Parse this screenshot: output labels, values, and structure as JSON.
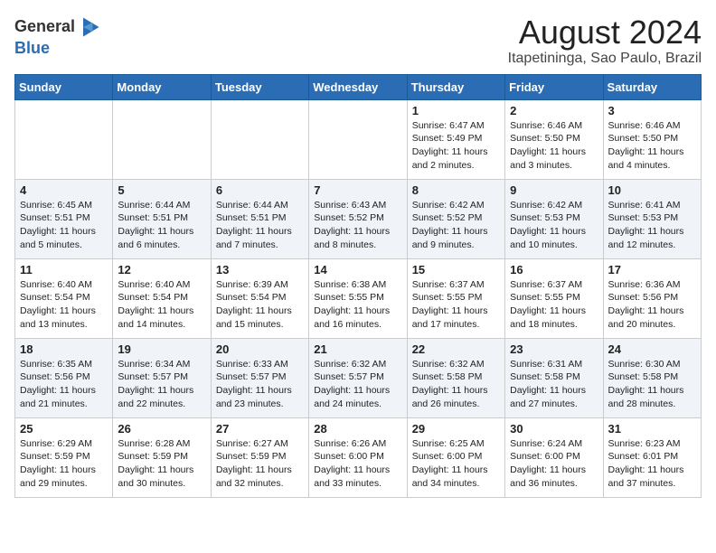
{
  "header": {
    "logo_general": "General",
    "logo_blue": "Blue",
    "month_year": "August 2024",
    "location": "Itapetininga, Sao Paulo, Brazil"
  },
  "days_of_week": [
    "Sunday",
    "Monday",
    "Tuesday",
    "Wednesday",
    "Thursday",
    "Friday",
    "Saturday"
  ],
  "weeks": [
    [
      {
        "day": "",
        "info": ""
      },
      {
        "day": "",
        "info": ""
      },
      {
        "day": "",
        "info": ""
      },
      {
        "day": "",
        "info": ""
      },
      {
        "day": "1",
        "info": "Sunrise: 6:47 AM\nSunset: 5:49 PM\nDaylight: 11 hours\nand 2 minutes."
      },
      {
        "day": "2",
        "info": "Sunrise: 6:46 AM\nSunset: 5:50 PM\nDaylight: 11 hours\nand 3 minutes."
      },
      {
        "day": "3",
        "info": "Sunrise: 6:46 AM\nSunset: 5:50 PM\nDaylight: 11 hours\nand 4 minutes."
      }
    ],
    [
      {
        "day": "4",
        "info": "Sunrise: 6:45 AM\nSunset: 5:51 PM\nDaylight: 11 hours\nand 5 minutes."
      },
      {
        "day": "5",
        "info": "Sunrise: 6:44 AM\nSunset: 5:51 PM\nDaylight: 11 hours\nand 6 minutes."
      },
      {
        "day": "6",
        "info": "Sunrise: 6:44 AM\nSunset: 5:51 PM\nDaylight: 11 hours\nand 7 minutes."
      },
      {
        "day": "7",
        "info": "Sunrise: 6:43 AM\nSunset: 5:52 PM\nDaylight: 11 hours\nand 8 minutes."
      },
      {
        "day": "8",
        "info": "Sunrise: 6:42 AM\nSunset: 5:52 PM\nDaylight: 11 hours\nand 9 minutes."
      },
      {
        "day": "9",
        "info": "Sunrise: 6:42 AM\nSunset: 5:53 PM\nDaylight: 11 hours\nand 10 minutes."
      },
      {
        "day": "10",
        "info": "Sunrise: 6:41 AM\nSunset: 5:53 PM\nDaylight: 11 hours\nand 12 minutes."
      }
    ],
    [
      {
        "day": "11",
        "info": "Sunrise: 6:40 AM\nSunset: 5:54 PM\nDaylight: 11 hours\nand 13 minutes."
      },
      {
        "day": "12",
        "info": "Sunrise: 6:40 AM\nSunset: 5:54 PM\nDaylight: 11 hours\nand 14 minutes."
      },
      {
        "day": "13",
        "info": "Sunrise: 6:39 AM\nSunset: 5:54 PM\nDaylight: 11 hours\nand 15 minutes."
      },
      {
        "day": "14",
        "info": "Sunrise: 6:38 AM\nSunset: 5:55 PM\nDaylight: 11 hours\nand 16 minutes."
      },
      {
        "day": "15",
        "info": "Sunrise: 6:37 AM\nSunset: 5:55 PM\nDaylight: 11 hours\nand 17 minutes."
      },
      {
        "day": "16",
        "info": "Sunrise: 6:37 AM\nSunset: 5:55 PM\nDaylight: 11 hours\nand 18 minutes."
      },
      {
        "day": "17",
        "info": "Sunrise: 6:36 AM\nSunset: 5:56 PM\nDaylight: 11 hours\nand 20 minutes."
      }
    ],
    [
      {
        "day": "18",
        "info": "Sunrise: 6:35 AM\nSunset: 5:56 PM\nDaylight: 11 hours\nand 21 minutes."
      },
      {
        "day": "19",
        "info": "Sunrise: 6:34 AM\nSunset: 5:57 PM\nDaylight: 11 hours\nand 22 minutes."
      },
      {
        "day": "20",
        "info": "Sunrise: 6:33 AM\nSunset: 5:57 PM\nDaylight: 11 hours\nand 23 minutes."
      },
      {
        "day": "21",
        "info": "Sunrise: 6:32 AM\nSunset: 5:57 PM\nDaylight: 11 hours\nand 24 minutes."
      },
      {
        "day": "22",
        "info": "Sunrise: 6:32 AM\nSunset: 5:58 PM\nDaylight: 11 hours\nand 26 minutes."
      },
      {
        "day": "23",
        "info": "Sunrise: 6:31 AM\nSunset: 5:58 PM\nDaylight: 11 hours\nand 27 minutes."
      },
      {
        "day": "24",
        "info": "Sunrise: 6:30 AM\nSunset: 5:58 PM\nDaylight: 11 hours\nand 28 minutes."
      }
    ],
    [
      {
        "day": "25",
        "info": "Sunrise: 6:29 AM\nSunset: 5:59 PM\nDaylight: 11 hours\nand 29 minutes."
      },
      {
        "day": "26",
        "info": "Sunrise: 6:28 AM\nSunset: 5:59 PM\nDaylight: 11 hours\nand 30 minutes."
      },
      {
        "day": "27",
        "info": "Sunrise: 6:27 AM\nSunset: 5:59 PM\nDaylight: 11 hours\nand 32 minutes."
      },
      {
        "day": "28",
        "info": "Sunrise: 6:26 AM\nSunset: 6:00 PM\nDaylight: 11 hours\nand 33 minutes."
      },
      {
        "day": "29",
        "info": "Sunrise: 6:25 AM\nSunset: 6:00 PM\nDaylight: 11 hours\nand 34 minutes."
      },
      {
        "day": "30",
        "info": "Sunrise: 6:24 AM\nSunset: 6:00 PM\nDaylight: 11 hours\nand 36 minutes."
      },
      {
        "day": "31",
        "info": "Sunrise: 6:23 AM\nSunset: 6:01 PM\nDaylight: 11 hours\nand 37 minutes."
      }
    ]
  ]
}
